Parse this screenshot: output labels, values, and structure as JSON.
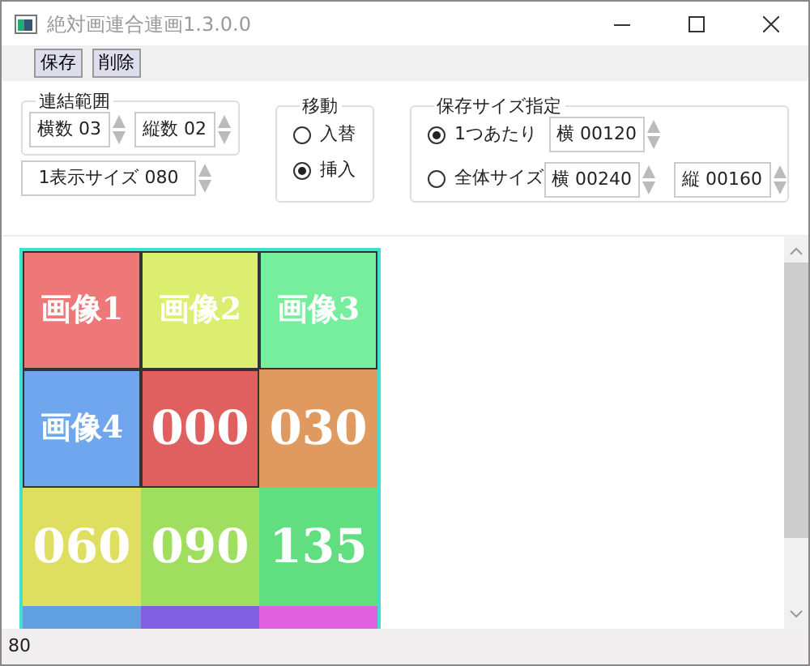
{
  "window": {
    "title": "絶対画連合連画1.3.0.0"
  },
  "toolbar": [
    {
      "label": "保存"
    },
    {
      "label": "削除"
    }
  ],
  "link_range": {
    "title": "連結範囲",
    "spinners": [
      {
        "value": "横数 03"
      },
      {
        "value": "縦数 02"
      }
    ]
  },
  "display_size": {
    "value": "1表示サイズ 080"
  },
  "move": {
    "title": "移動",
    "options": [
      {
        "label": "入替",
        "selected": false
      },
      {
        "label": "挿入",
        "selected": true
      }
    ]
  },
  "save_size": {
    "title": "保存サイズ指定",
    "options": [
      {
        "label": "1つあたり",
        "selected": true,
        "spinners": [
          {
            "value": "横 00120"
          }
        ]
      },
      {
        "label": "全体サイズ",
        "selected": false,
        "spinners": [
          {
            "value": "横 00240"
          },
          {
            "value": "縦 00160"
          }
        ]
      }
    ]
  },
  "tiles": [
    {
      "label": "画像1",
      "kind": "name",
      "color": "#ee7777",
      "framed": true
    },
    {
      "label": "画像2",
      "kind": "name",
      "color": "#dcee70",
      "framed": true
    },
    {
      "label": "画像3",
      "kind": "name",
      "color": "#77ee9e",
      "framed": true
    },
    {
      "label": "画像4",
      "kind": "name",
      "color": "#6fa6ee",
      "framed": true
    },
    {
      "label": "000",
      "color": "#e06060",
      "framed": true
    },
    {
      "label": "030",
      "color": "#e09a60",
      "framed": false
    },
    {
      "label": "060",
      "color": "#dede60",
      "framed": false
    },
    {
      "label": "090",
      "color": "#a0de60",
      "framed": false
    },
    {
      "label": "135",
      "color": "#60de80",
      "framed": false
    },
    {
      "color": "#60a0e0",
      "framed": false
    },
    {
      "color": "#8060e0",
      "framed": false
    },
    {
      "color": "#e060e0",
      "framed": false
    }
  ],
  "status_bar": "80"
}
